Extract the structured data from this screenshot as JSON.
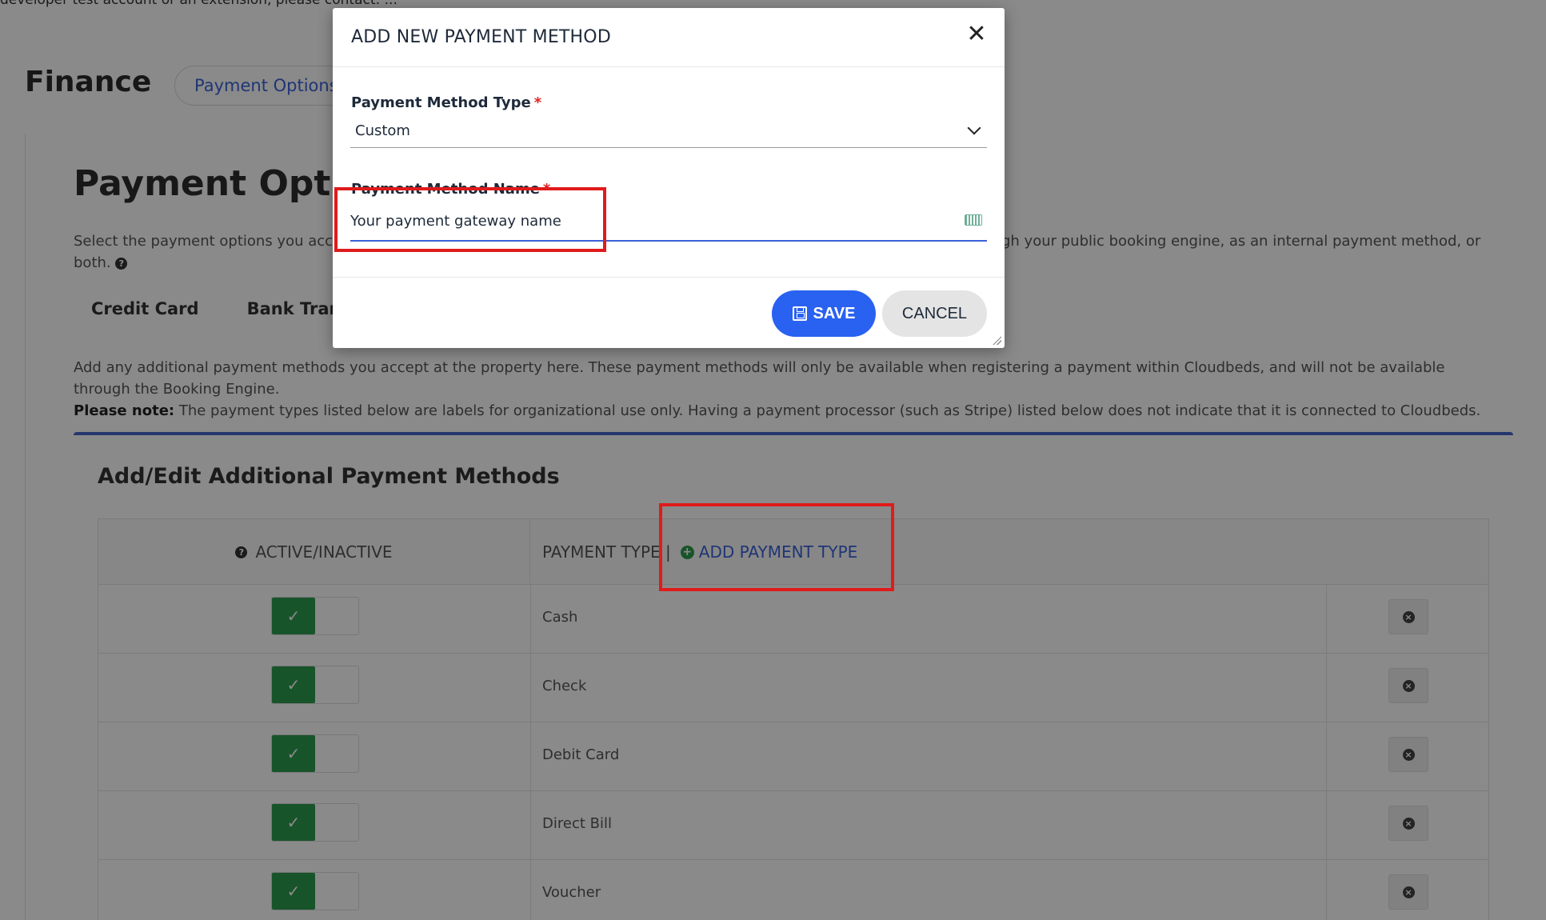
{
  "background": {
    "top_notice": "developer test account or an extension, please contact: ...",
    "page_title": "Finance",
    "active_tab": "Payment Options",
    "section_title": "Payment Options",
    "description_left": "Select the payment options you accept. These will be available through your public booking engine, as an internal payment method, or both.",
    "description_left_visible": "Select the payment options you acc",
    "description_right_visible": "gh your public booking engine, as an internal payment method, or",
    "description_line2": "both.",
    "subtabs": [
      "Credit Card",
      "Bank Trans"
    ],
    "additional_desc_line1": "Add any additional payment methods you accept at the property here. These payment methods will only be available when registering a payment within Cloudbeds, and will not be available through the Booking Engine.",
    "please_note_label": "Please note:",
    "please_note_text": "The payment types listed below are labels for organizational use only. Having a payment processor (such as Stripe) listed below does not indicate that it is connected to Cloudbeds.",
    "panel_title": "Add/Edit Additional Payment Methods",
    "table": {
      "col_active": "ACTIVE/INACTIVE",
      "col_type": "PAYMENT TYPE |",
      "add_type_label": "ADD PAYMENT TYPE",
      "rows": [
        {
          "label": "Cash",
          "active": true
        },
        {
          "label": "Check",
          "active": true
        },
        {
          "label": "Debit Card",
          "active": true
        },
        {
          "label": "Direct Bill",
          "active": true
        },
        {
          "label": "Voucher",
          "active": true
        }
      ]
    }
  },
  "modal": {
    "title": "ADD NEW PAYMENT METHOD",
    "type_label": "Payment Method Type",
    "type_value": "Custom",
    "name_label": "Payment Method Name",
    "name_value": "Your payment gateway name",
    "save_label": "SAVE",
    "cancel_label": "CANCEL",
    "close_symbol": "✕"
  },
  "colors": {
    "accent": "#2962f0",
    "link": "#3a63d9",
    "active_toggle": "#2e9c4f",
    "highlight": "#e01b1b",
    "required": "#e02424"
  }
}
